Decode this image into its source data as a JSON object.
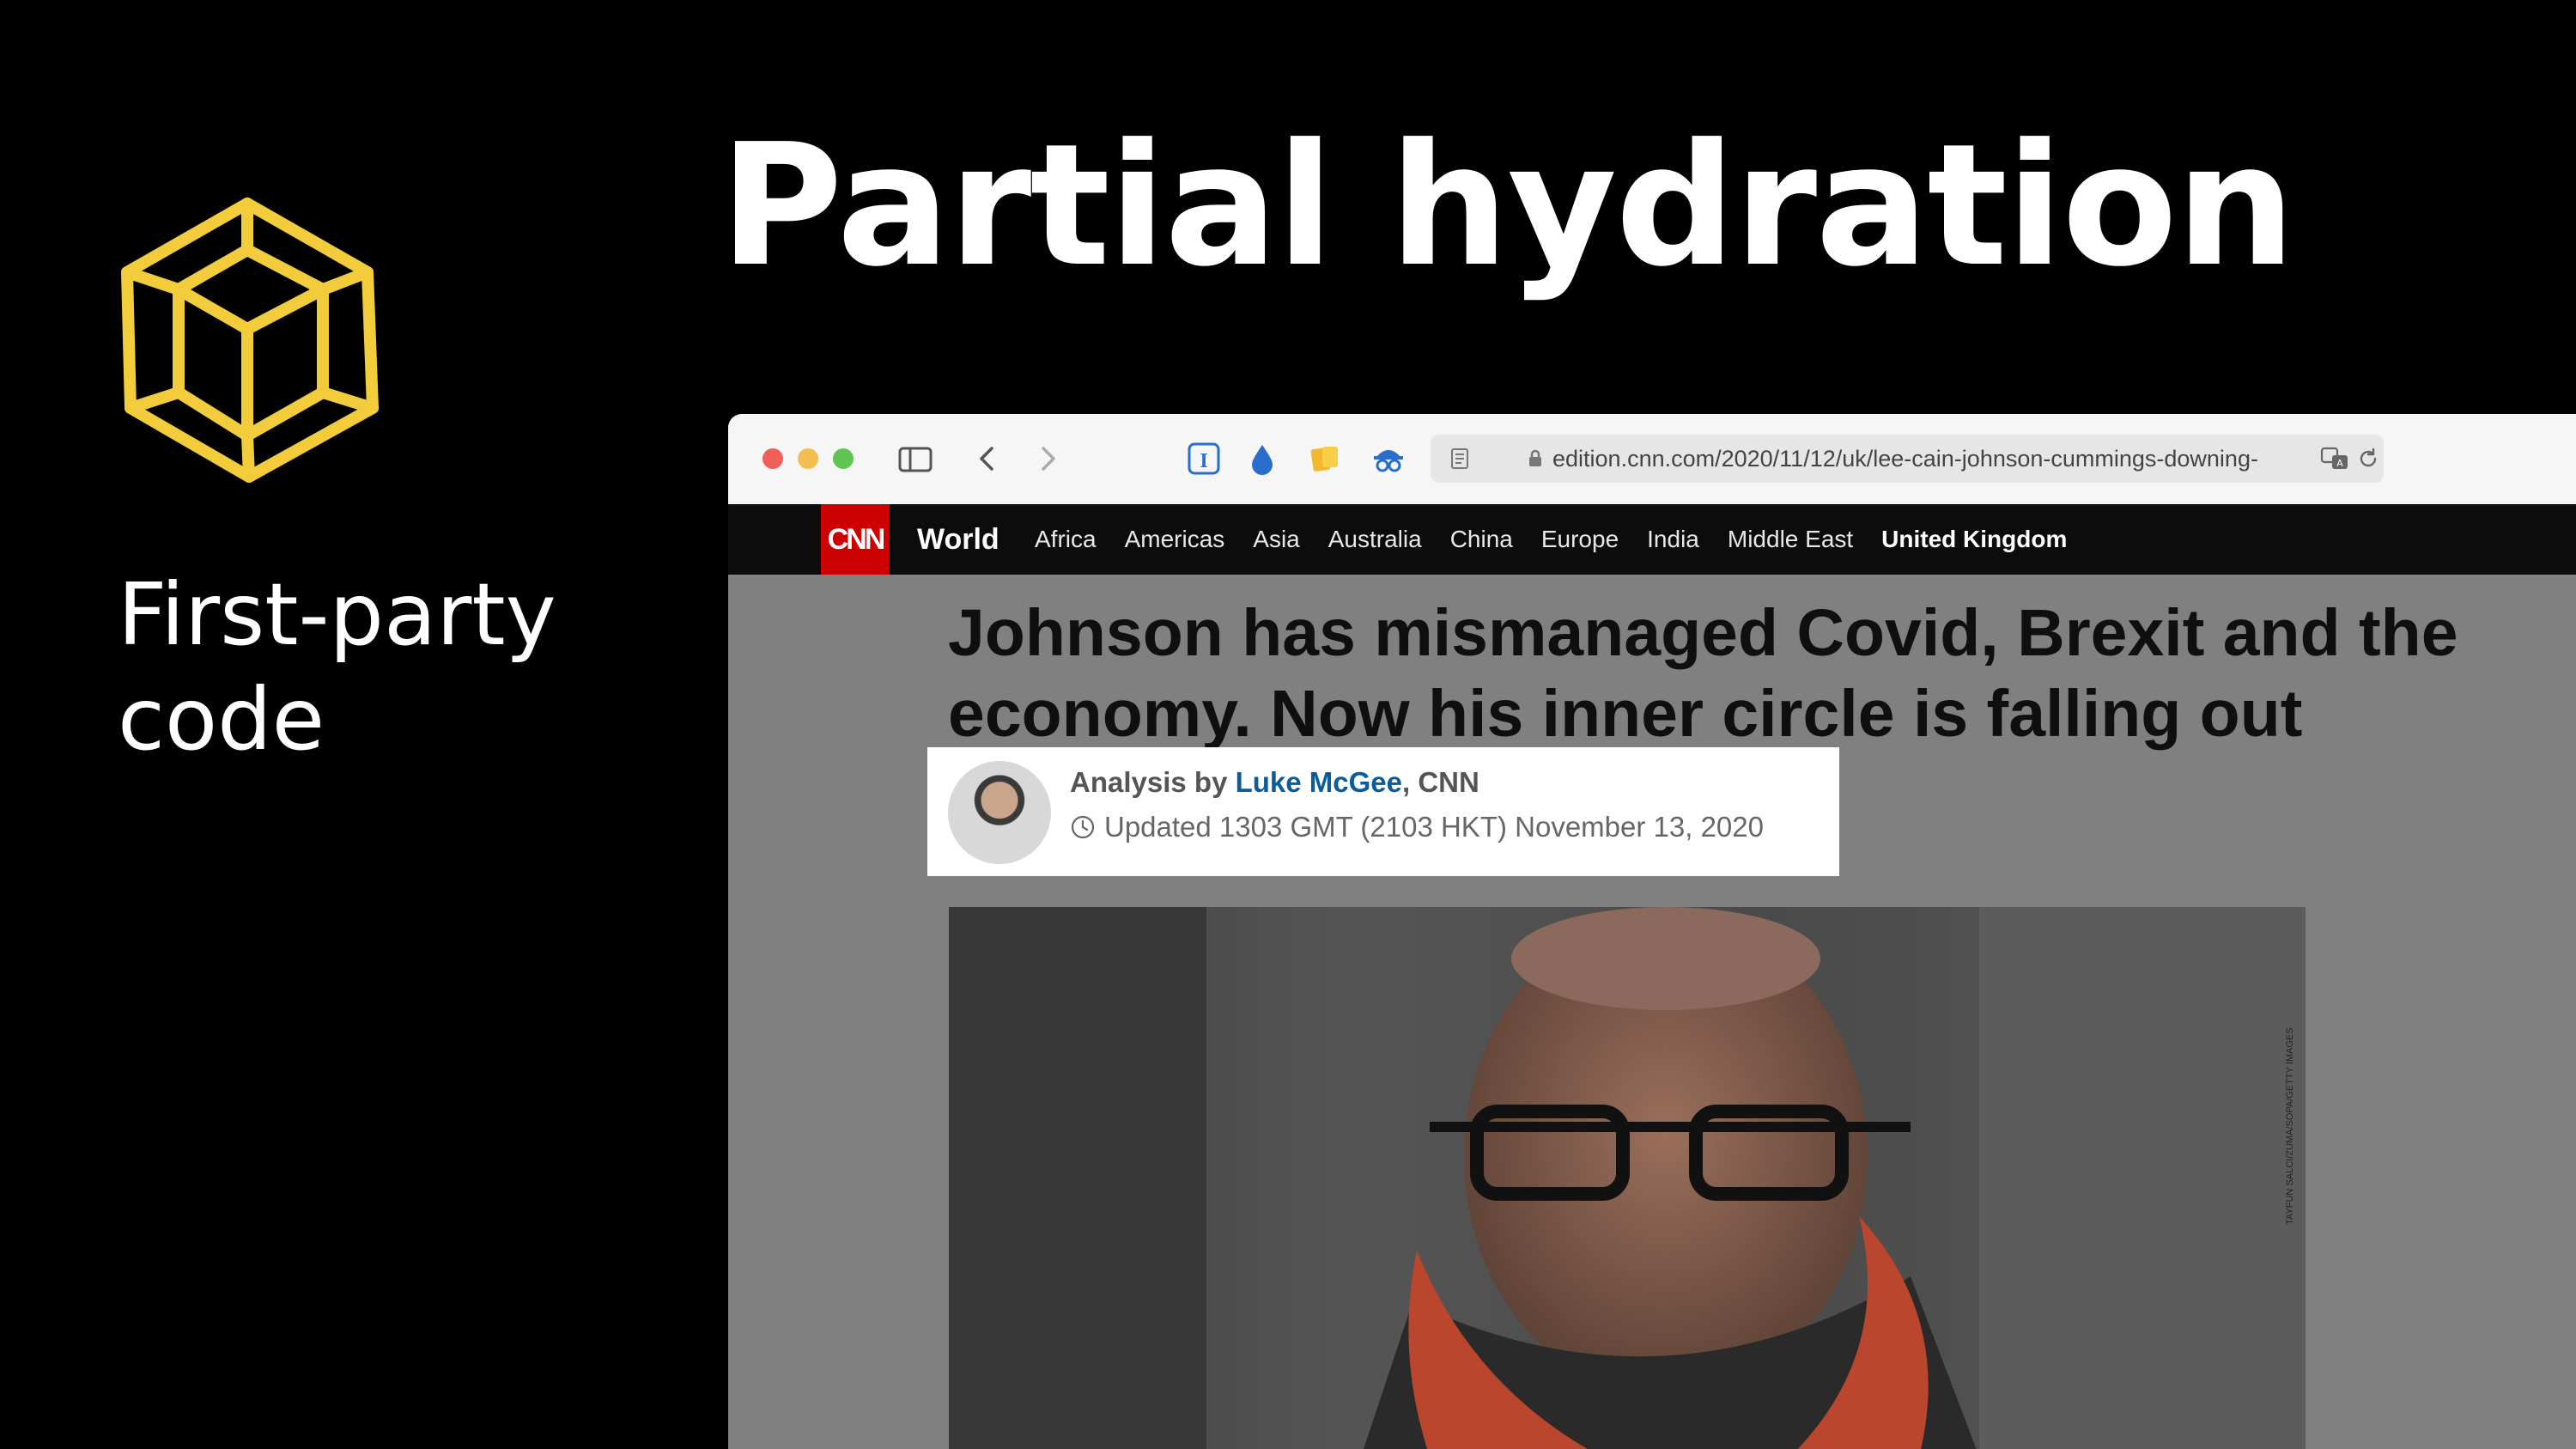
{
  "slide": {
    "title": "Partial hydration",
    "side_label": "First-party code",
    "accent_color": "#f2cc3a",
    "logo_icon": "wireframe-cube-icon"
  },
  "browser": {
    "url": "edition.cnn.com/2020/11/12/uk/lee-cain-johnson-cummings-downing-",
    "traffic_lights": [
      "#ee5f57",
      "#f4bd4f",
      "#5fc454"
    ],
    "toolbar_icons": [
      "sidebar-icon",
      "back-chevron-icon",
      "forward-chevron-icon",
      "instapaper-icon",
      "drop-icon",
      "notes-icon",
      "spy-icon",
      "reader-icon",
      "lock-icon",
      "translate-icon",
      "reload-icon"
    ]
  },
  "cnn": {
    "logo": "CNN",
    "section": "World",
    "nav": [
      "Africa",
      "Americas",
      "Asia",
      "Australia",
      "China",
      "Europe",
      "India",
      "Middle East",
      "United Kingdom"
    ],
    "active_nav": "United Kingdom",
    "headline_line1": "Johnson has mismanaged Covid, Brexit and the",
    "headline_line2": "economy. Now his inner circle is falling out",
    "byline_prefix": "Analysis by",
    "author": "Luke McGee",
    "outlet": ", CNN",
    "updated": "Updated 1303 GMT (2103 HKT) November 13, 2020",
    "photo_credit": "TAYFUN SALCI/ZUMA/SOPA/GETTY IMAGES"
  }
}
